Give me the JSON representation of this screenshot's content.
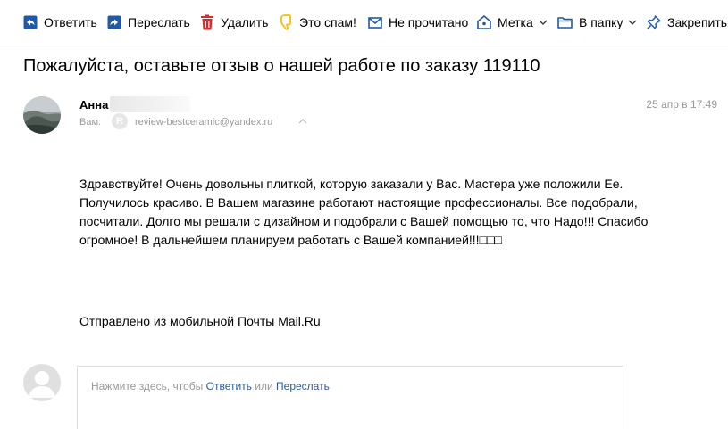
{
  "toolbar": {
    "reply": "Ответить",
    "forward": "Переслать",
    "delete": "Удалить",
    "spam": "Это спам!",
    "unread": "Не прочитано",
    "label": "Метка",
    "folder": "В папку",
    "pin": "Закрепить"
  },
  "message": {
    "subject": "Пожалуйста, оставьте отзыв о нашей работе по заказу 119110",
    "sender_name": "Анна",
    "to_label": "Вам:",
    "to_badge": "R",
    "to_email": "review-bestceramic@yandex.ru",
    "date": "25 апр в 17:49",
    "body": [
      "Здравствуйте! Очень довольны плиткой, которую заказали у Вас. Мастера уже положили Ее.",
      "Получилось красиво. В Вашем магазине работают настоящие профессионалы. Все подобрали,",
      "посчитали.  Долго мы решали с дизайном и подобрали с Вашей помощью то, что Надо!!! Спасибо",
      "огромное! В дальнейшем планируем работать с Вашей компанией!!!□□□"
    ],
    "signature": "Отправлено из мобильной Почты Mail.Ru"
  },
  "reply": {
    "prefix": "Нажмите здесь, чтобы ",
    "reply_link": "Ответить",
    "or": " или ",
    "forward_link": "Переслать"
  },
  "colors": {
    "icon_blue": "#1e5aa8",
    "delete_red": "#e1262b",
    "spam_yellow": "#f6c000",
    "link": "#2c5b9e",
    "muted": "#999999"
  }
}
